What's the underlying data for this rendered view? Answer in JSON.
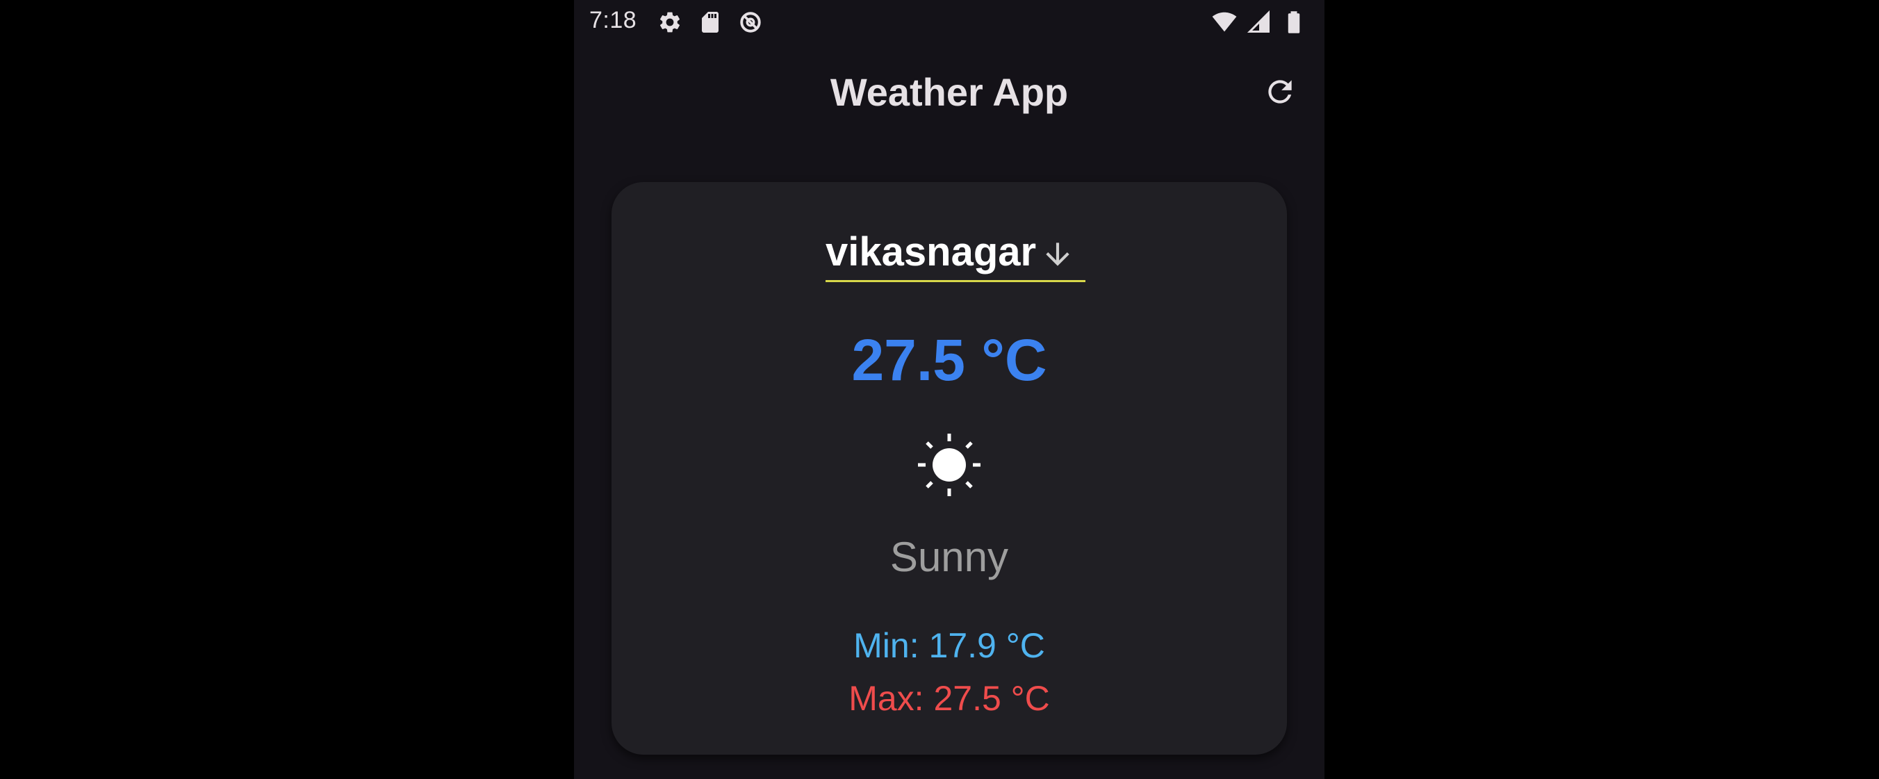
{
  "status_bar": {
    "time": "7:18",
    "left_icons": [
      "settings-gear-icon",
      "sd-card-icon",
      "data-saver-icon"
    ],
    "right_icons": [
      "wifi-icon",
      "cell-signal-icon",
      "battery-icon"
    ]
  },
  "app_bar": {
    "title": "Weather App",
    "refresh_icon": "refresh-icon"
  },
  "weather": {
    "city": "vikasnagar",
    "temperature": "27.5 °C",
    "condition_icon": "sun-icon",
    "condition": "Sunny",
    "min": "Min: 17.9 °C",
    "max": "Max: 27.5 °C"
  },
  "colors": {
    "background": "#141218",
    "card": "#201f24",
    "temperature": "#3b82f0",
    "min": "#4fb3ef",
    "max": "#ef4c4c",
    "underline": "#d8d84a"
  }
}
